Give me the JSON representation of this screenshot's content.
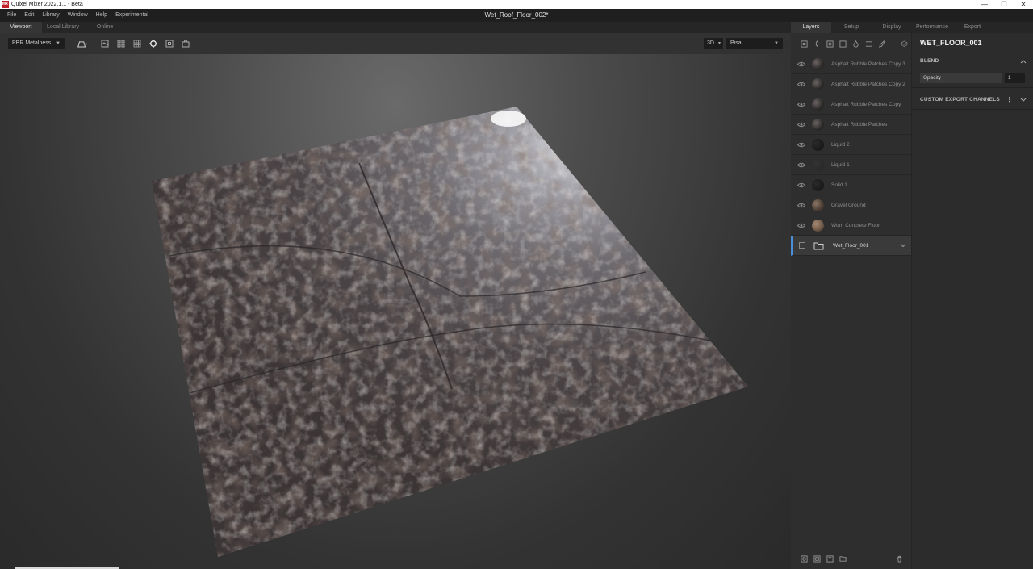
{
  "window": {
    "app_title": "Quixel Mixer 2022.1.1 - Beta",
    "app_icon_text": "Mx",
    "minimize": "—",
    "restore": "❐",
    "close": "✕"
  },
  "menu": [
    "File",
    "Edit",
    "Library",
    "Window",
    "Help",
    "Experimental"
  ],
  "document_title": "Wet_Roof_Floor_002*",
  "viewport_tabs": [
    {
      "label": "Viewport",
      "active": true
    },
    {
      "label": "Local Library",
      "active": false
    },
    {
      "label": "Online",
      "active": false
    }
  ],
  "viewport_toolbar": {
    "mode_select": "PBR Metalness",
    "view_mode": "3D",
    "environment": "Pisa",
    "icons": [
      "camera-shape-icon",
      "height-view-icon",
      "tile-view-icon",
      "grid-view-icon",
      "focus-target-icon",
      "frame-icon",
      "screenshot-icon"
    ]
  },
  "right_tabs": [
    {
      "label": "Layers",
      "active": true
    },
    {
      "label": "Setup",
      "active": false
    },
    {
      "label": "Display",
      "active": false
    },
    {
      "label": "Performance",
      "active": false
    },
    {
      "label": "Export",
      "active": false
    }
  ],
  "layers": [
    {
      "name": "Asphalt Rubble Patches Copy 3",
      "thumb": "dark-rubble"
    },
    {
      "name": "Asphalt Rubble Patches Copy 2",
      "thumb": "dark-rubble"
    },
    {
      "name": "Asphalt Rubble Patches Copy",
      "thumb": "dark-rubble"
    },
    {
      "name": "Asphalt Rubble Patches",
      "thumb": "dark-rubble"
    },
    {
      "name": "Liquid 2",
      "thumb": "black"
    },
    {
      "name": "Liquid 1",
      "thumb": "dark-gray"
    },
    {
      "name": "Solid 1",
      "thumb": "black"
    },
    {
      "name": "Gravel Ground",
      "thumb": "gravel"
    },
    {
      "name": "Worn Concrete Floor",
      "thumb": "concrete"
    }
  ],
  "group_layer": {
    "name": "Wet_Floor_001"
  },
  "properties": {
    "title": "WET_FLOOR_001",
    "blend_section": "BLEND",
    "opacity_label": "Opacity",
    "opacity_value": "1",
    "export_section": "CUSTOM EXPORT CHANNELS"
  },
  "colors": {
    "accent": "#4a90d9",
    "app_icon": "#c0202a"
  }
}
